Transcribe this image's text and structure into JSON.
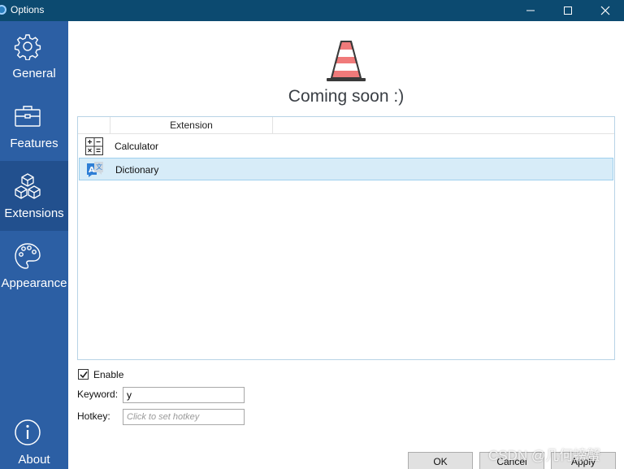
{
  "window": {
    "title": "Options",
    "titlebar_color": "#0c4a70"
  },
  "sidebar": {
    "background": "#2c5fa4",
    "items": [
      {
        "label": "General",
        "icon": "gear-icon",
        "active": false
      },
      {
        "label": "Features",
        "icon": "briefcase-icon",
        "active": false
      },
      {
        "label": "Extensions",
        "icon": "cubes-icon",
        "active": true
      },
      {
        "label": "Appearance",
        "icon": "palette-icon",
        "active": false
      },
      {
        "label": "About",
        "icon": "info-icon",
        "active": false
      }
    ]
  },
  "main": {
    "coming_soon": "Coming soon :)",
    "extensions": {
      "column_header": "Extension",
      "rows": [
        {
          "label": "Calculator",
          "icon": "calculator-icon",
          "selected": false
        },
        {
          "label": "Dictionary",
          "icon": "dictionary-icon",
          "selected": true
        }
      ]
    },
    "enable": {
      "label": "Enable",
      "checked": true
    },
    "keyword": {
      "label": "Keyword:",
      "value": "y"
    },
    "hotkey": {
      "label": "Hotkey:",
      "placeholder": "Click to set hotkey"
    }
  },
  "buttons": {
    "ok": "OK",
    "cancel": "Cancel",
    "apply": "Apply"
  },
  "watermark": "CSDN @几何螃蟹"
}
